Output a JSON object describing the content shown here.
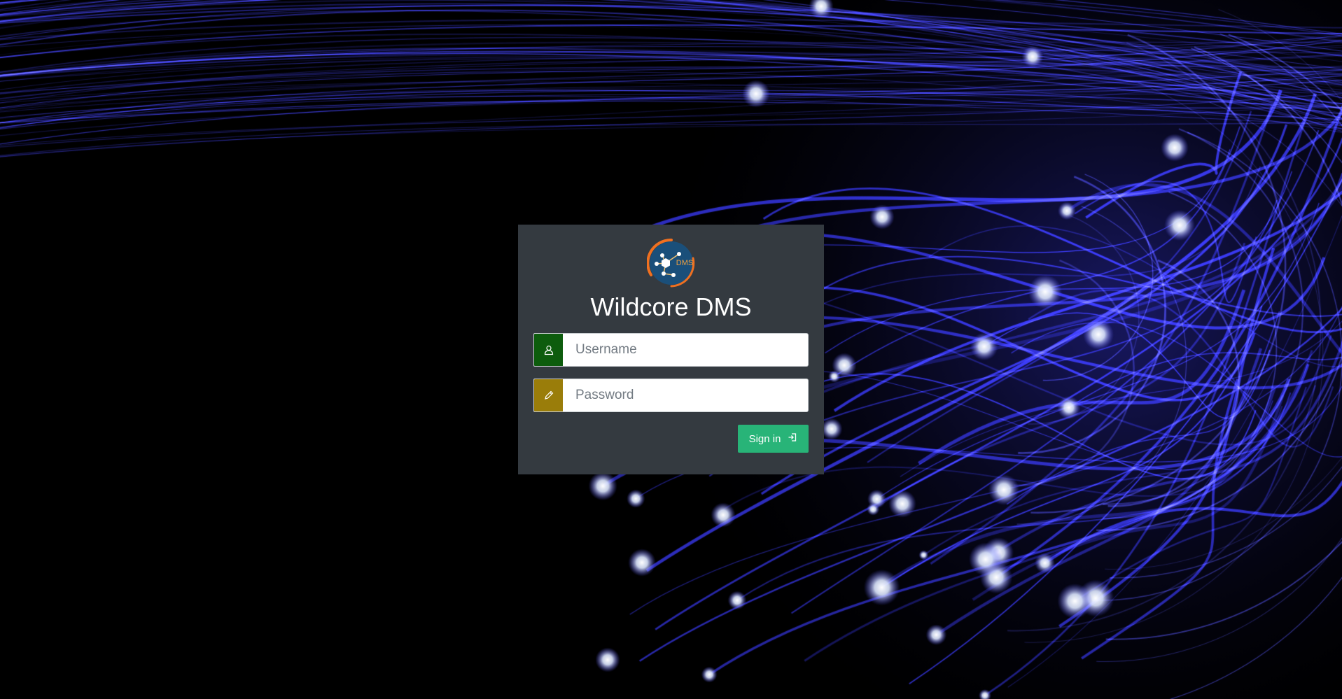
{
  "app": {
    "title": "Wildcore DMS",
    "logo_text": "DMS"
  },
  "login": {
    "username_placeholder": "Username",
    "password_placeholder": "Password",
    "signin_label": "Sign in"
  },
  "icons": {
    "username": "user-icon",
    "password": "pencil-icon",
    "signin": "sign-in-icon"
  },
  "colors": {
    "background": "#000000",
    "fiber": "#3c3cf0",
    "card": "#343a40",
    "username_addon": "#0d5c0d",
    "password_addon": "#9a7d0a",
    "signin_button": "#28b478",
    "logo_ring": "#f07020",
    "logo_fill": "#1a4f7a"
  }
}
